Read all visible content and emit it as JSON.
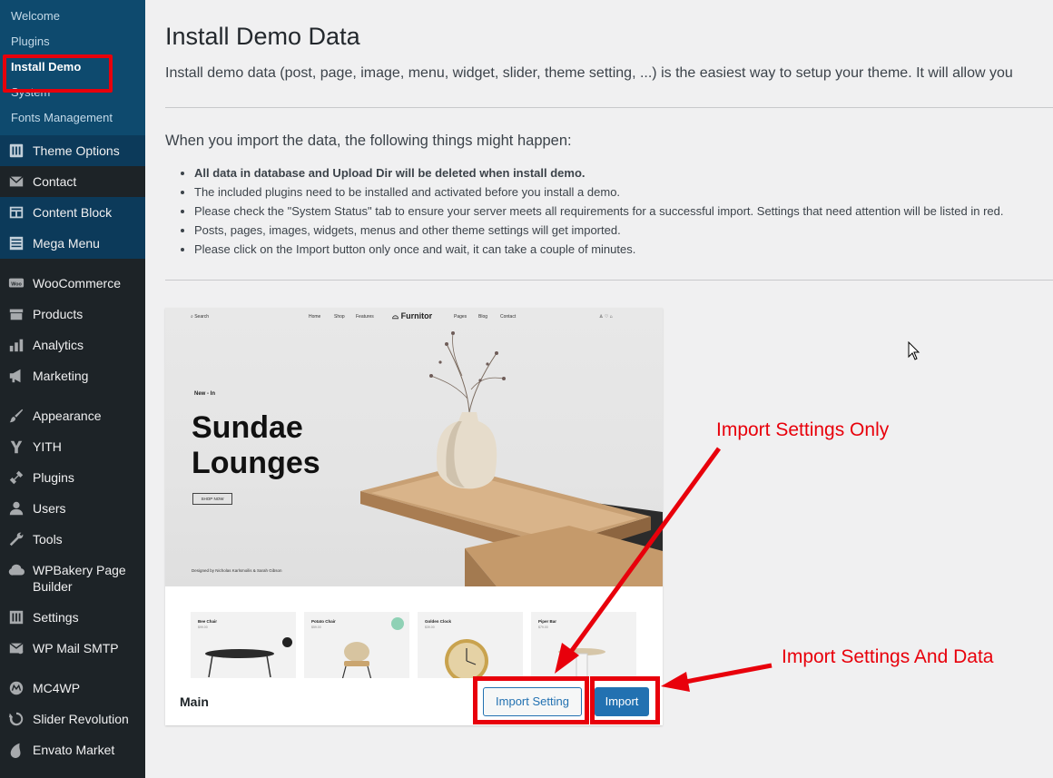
{
  "sidebar": {
    "submenu": [
      {
        "label": "Welcome"
      },
      {
        "label": "Plugins"
      },
      {
        "label": "Install Demo"
      },
      {
        "label": "System"
      },
      {
        "label": "Fonts Management"
      }
    ],
    "theme_items": [
      {
        "label": "Theme Options",
        "icon": "theme-options-icon"
      },
      {
        "label": "Contact",
        "icon": "envelope-icon"
      },
      {
        "label": "Content Block",
        "icon": "content-block-icon"
      },
      {
        "label": "Mega Menu",
        "icon": "mega-menu-icon"
      }
    ],
    "group1": [
      {
        "label": "WooCommerce",
        "icon": "woocommerce-icon"
      },
      {
        "label": "Products",
        "icon": "products-icon"
      },
      {
        "label": "Analytics",
        "icon": "analytics-icon"
      },
      {
        "label": "Marketing",
        "icon": "megaphone-icon"
      }
    ],
    "group2": [
      {
        "label": "Appearance",
        "icon": "paintbrush-icon"
      },
      {
        "label": "YITH",
        "icon": "yith-icon"
      },
      {
        "label": "Plugins",
        "icon": "plugins-icon"
      },
      {
        "label": "Users",
        "icon": "users-icon"
      },
      {
        "label": "Tools",
        "icon": "tools-icon"
      },
      {
        "label": "WPBakery Page Builder",
        "icon": "wpbakery-icon"
      },
      {
        "label": "Settings",
        "icon": "settings-icon"
      },
      {
        "label": "WP Mail SMTP",
        "icon": "mail-smtp-icon"
      }
    ],
    "group3": [
      {
        "label": "MC4WP",
        "icon": "mc4wp-icon"
      },
      {
        "label": "Slider Revolution",
        "icon": "slider-revolution-icon"
      },
      {
        "label": "Envato Market",
        "icon": "envato-icon"
      }
    ]
  },
  "main": {
    "title": "Install Demo Data",
    "intro": "Install demo data (post, page, image, menu, widget, slider, theme setting, ...) is the easiest way to setup your theme. It will allow you",
    "notice_heading": "When you import the data, the following things might happen:",
    "notices": [
      "All data in database and Upload Dir will be deleted when install demo.",
      "The included plugins need to be installed and activated before you install a demo.",
      "Please check the \"System Status\" tab to ensure your server meets all requirements for a successful import. Settings that need attention will be listed in red.",
      "Posts, pages, images, widgets, menus and other theme settings will get imported.",
      "Please click on the Import button only once and wait, it can take a couple of minutes."
    ]
  },
  "demo": {
    "name": "Main",
    "import_setting_label": "Import Setting",
    "import_label": "Import",
    "preview": {
      "search": "Search",
      "nav": [
        "Home",
        "Shop",
        "Features"
      ],
      "logo": "Furnitor",
      "nav_right": [
        "Pages",
        "Blog",
        "Contact"
      ],
      "eyebrow": "New - In",
      "headline": "Sundae Lounges",
      "cta": "SHOP NOW",
      "designed_by": "Designed by Nicholas Karlsmoilis & Sarah Gibson",
      "products": [
        {
          "name": "Bee Chair",
          "price": "$99.00"
        },
        {
          "name": "Potato Chair",
          "price": "$59.00"
        },
        {
          "name": "Golden Clock",
          "price": "$39.00"
        },
        {
          "name": "Piper Bar",
          "price": "$79.00"
        }
      ]
    }
  },
  "annotations": {
    "settings_only": "Import Settings Only",
    "settings_and_data": "Import Settings And Data"
  },
  "colors": {
    "sidebar_bg": "#1d2327",
    "submenu_bg": "#0e4a6e",
    "accent_red": "#e8000b",
    "button_blue": "#2271b1"
  }
}
